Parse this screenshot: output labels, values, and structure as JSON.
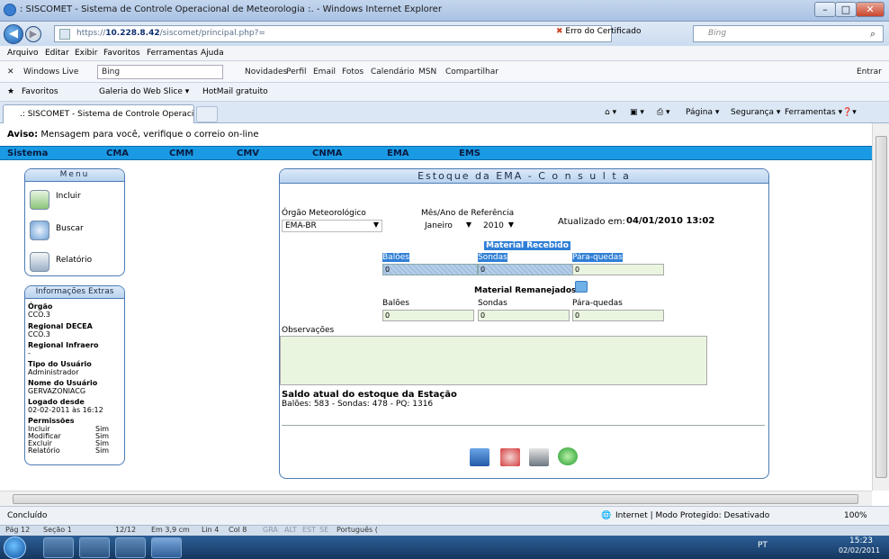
{
  "window": {
    "title": ": SISCOMET - Sistema de Controle Operacional de Meteorologia :. - Windows Internet Explorer",
    "minimize": "–",
    "maximize": "□",
    "close": "✕"
  },
  "address": {
    "url_prefix": "https://",
    "url_host": "10.228.8.42",
    "url_path": "/siscomet/principal.php?=",
    "cert_error": "Erro do Certificado",
    "search_placeholder": "Bing"
  },
  "menubar": [
    "Arquivo",
    "Editar",
    "Exibir",
    "Favoritos",
    "Ferramentas",
    "Ajuda"
  ],
  "livebar": {
    "brand": "Windows Live",
    "query": "Bing",
    "items": [
      "Novidades",
      "Perfil",
      "Email",
      "Fotos",
      "Calendário",
      "MSN",
      "Compartilhar"
    ],
    "signin": "Entrar"
  },
  "favbar": {
    "favorites": "Favoritos",
    "items": [
      "Galeria do Web Slice ▾",
      "HotMail gratuito"
    ]
  },
  "tabbar": {
    "tab_title": ".: SISCOMET - Sistema de Controle Operacional d...",
    "commands": [
      "Página ▾",
      "Segurança ▾",
      "Ferramentas ▾"
    ]
  },
  "aviso": {
    "label": "Aviso:",
    "text": "Mensagem para você, verifique o correio on-line"
  },
  "sysnav": [
    "Sistema",
    "CMA",
    "CMM",
    "CMV",
    "CNMA",
    "EMA",
    "EMS"
  ],
  "menu": {
    "title": "Menu",
    "items": [
      "Incluir",
      "Buscar",
      "Relatório"
    ]
  },
  "info": {
    "title": "Informações Extras",
    "orgao_label": "Órgão",
    "orgao": "CCO.3",
    "regional_decea_label": "Regional DECEA",
    "regional_decea": "CCO.3",
    "regional_infraero_label": "Regional Infraero",
    "regional_infraero": "-",
    "tipo_label": "Tipo do Usuário",
    "tipo": "Administrador",
    "nome_label": "Nome do Usuário",
    "nome": "GERVAZONIACG",
    "logado_label": "Logado desde",
    "logado": "02-02-2011 às 16:12",
    "permissoes_label": "Permissões",
    "permissoes": [
      {
        "name": "Incluir",
        "value": "Sim"
      },
      {
        "name": "Modificar",
        "value": "Sim"
      },
      {
        "name": "Excluir",
        "value": "Sim"
      },
      {
        "name": "Relatório",
        "value": "Sim"
      }
    ]
  },
  "main": {
    "title": "Estoque da EMA - C o n s u l t a",
    "orgao_label": "Órgão Meteorológico",
    "orgao_value": "EMA-BR",
    "mes_label": "Mês/Ano de Referência",
    "mes_value": "Janeiro",
    "ano_value": "2010",
    "atualizado_label": "Atualizado em:",
    "atualizado_value": "04/01/2010 13:02",
    "recebido_title": "Material Recebido",
    "recebido": {
      "baloes_label": "Balões",
      "baloes": "0",
      "sondas_label": "Sondas",
      "sondas": "0",
      "paraquedas_label": "Pára-quedas",
      "paraquedas": "0"
    },
    "remanejados_title": "Material Remanejados",
    "remanejados": {
      "baloes_label": "Balões",
      "baloes": "0",
      "sondas_label": "Sondas",
      "sondas": "0",
      "paraquedas_label": "Pára-quedas",
      "paraquedas": "0"
    },
    "obs_label": "Observações",
    "saldo_title": "Saldo atual do estoque da Estação",
    "saldo_text": "Balões: 583 - Sondas: 478 - PQ: 1316"
  },
  "status": {
    "text": "Concluído",
    "zone": "Internet | Modo Protegido: Desativado",
    "zoom": "100%"
  },
  "wordbar": [
    "Pág 12",
    "Seção 1",
    "12/12",
    "Em 3,9 cm",
    "Lin 4",
    "Col 8",
    "GRA",
    "ALT",
    "EST",
    "SE",
    "Português ("
  ],
  "taskbar": {
    "lang": "PT",
    "time": "15:23",
    "date": "02/02/2011"
  }
}
